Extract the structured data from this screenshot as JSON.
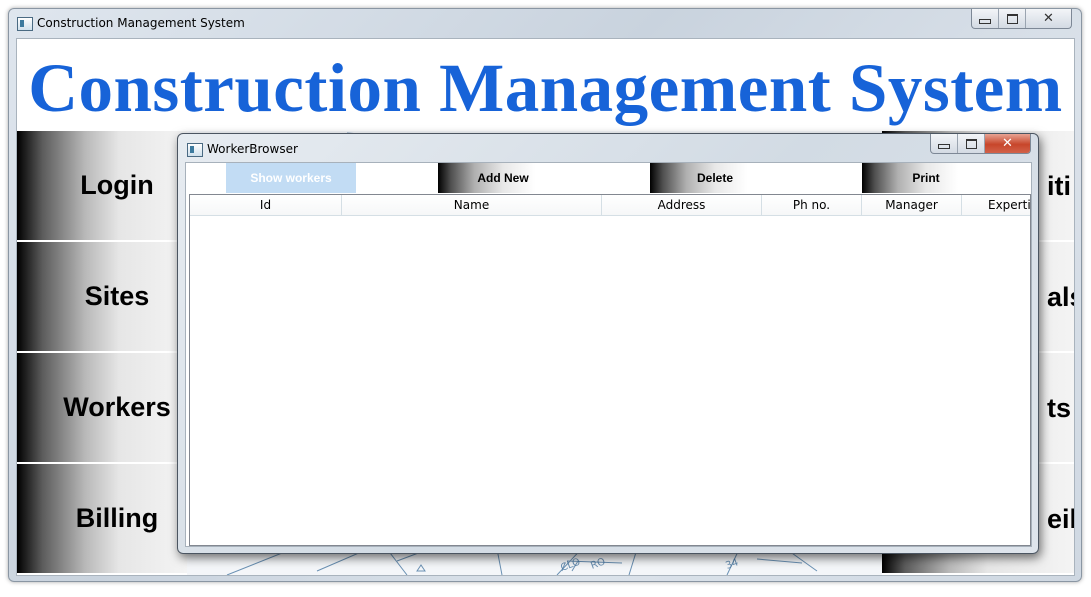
{
  "main_window": {
    "title": "Construction Management System",
    "banner": "Construction Management System",
    "left_nav": [
      "Login",
      "Sites",
      "Workers",
      "Billing"
    ],
    "right_nav_visible_fragments": [
      "iti",
      "als",
      "ts",
      "eila"
    ]
  },
  "dialog": {
    "title": "WorkerBrowser",
    "toolbar": {
      "show_workers": "Show workers",
      "add_new": "Add New",
      "delete": "Delete",
      "print": "Print"
    },
    "grid": {
      "columns": [
        "Id",
        "Name",
        "Address",
        "Ph no.",
        "Manager",
        "Expertise"
      ],
      "rows": []
    }
  },
  "colors": {
    "banner_blue": "#1763d8",
    "show_workers_bg": "#c2dcf4"
  },
  "icons": {
    "minimize": "minimize-icon",
    "maximize": "maximize-icon",
    "close": "close-icon"
  }
}
